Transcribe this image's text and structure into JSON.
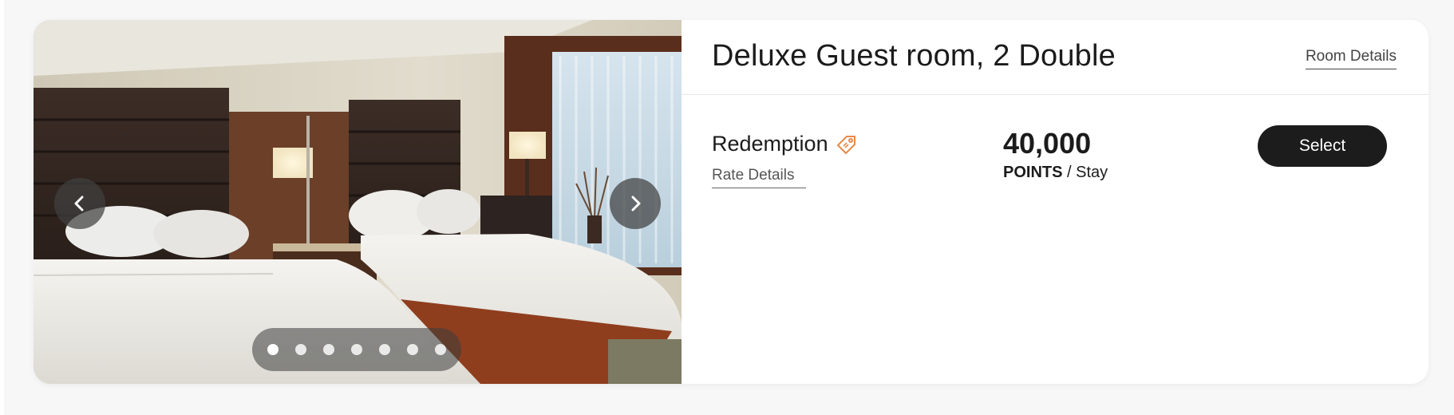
{
  "room": {
    "title": "Deluxe Guest room, 2 Double",
    "details_link": "Room Details"
  },
  "rate": {
    "name": "Redemption",
    "tag_icon": "tag-icon",
    "details_link": "Rate Details",
    "points": "40,000",
    "points_label": "POINTS",
    "per": "/ Stay",
    "select_label": "Select"
  },
  "carousel": {
    "prev_icon": "chevron-left-icon",
    "next_icon": "chevron-right-icon",
    "slide_count": 7,
    "active_slide": 1
  },
  "colors": {
    "accent_tag": "#e8894a",
    "button_bg": "#1c1c1c"
  }
}
